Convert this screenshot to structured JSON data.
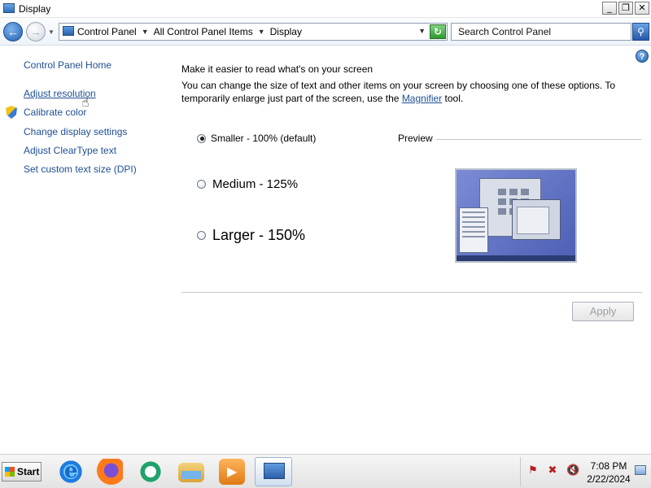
{
  "window": {
    "title": "Display",
    "minimize": "_",
    "restore": "❐",
    "close": "✕"
  },
  "addressbar": {
    "crumbs": [
      "Control Panel",
      "All Control Panel Items",
      "Display"
    ],
    "search_text": "Search Control Panel"
  },
  "sidebar": {
    "home": "Control Panel Home",
    "items": [
      "Adjust resolution",
      "Calibrate color",
      "Change display settings",
      "Adjust ClearType text",
      "Set custom text size (DPI)"
    ]
  },
  "main": {
    "heading": "Make it easier to read what's on your screen",
    "desc_before": "You can change the size of text and other items on your screen by choosing one of these options. To temporarily enlarge just part of the screen, use the ",
    "desc_link": "Magnifier",
    "desc_after": " tool.",
    "options": [
      {
        "label": "Smaller - 100% (default)",
        "checked": true
      },
      {
        "label": "Medium - 125%",
        "checked": false
      },
      {
        "label": "Larger - 150%",
        "checked": false
      }
    ],
    "preview_label": "Preview",
    "apply": "Apply"
  },
  "taskbar": {
    "start": "Start",
    "time": "7:08 PM",
    "date": "2/22/2024"
  }
}
